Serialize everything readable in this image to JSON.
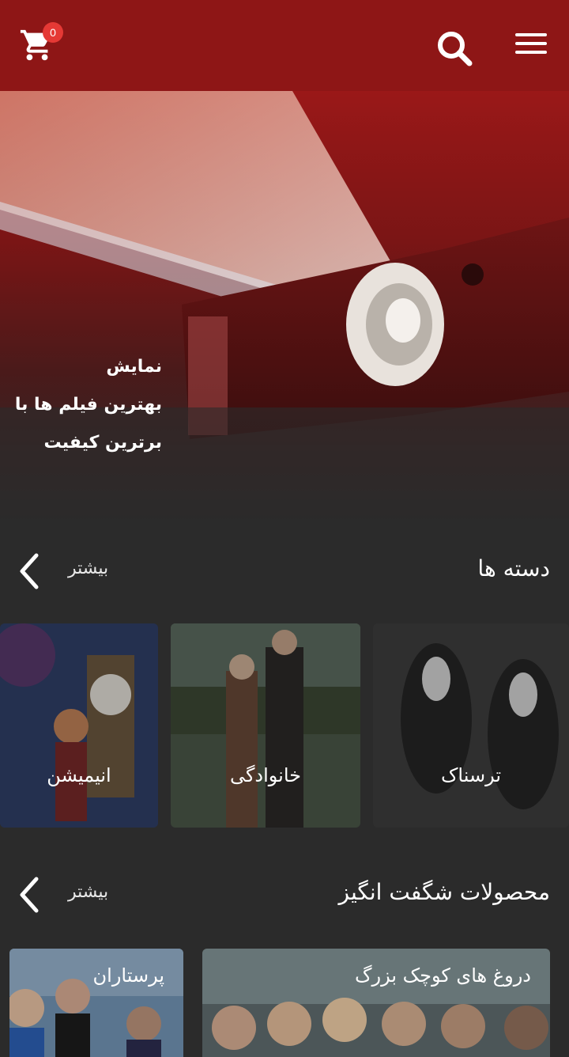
{
  "header": {
    "cart_count": "0",
    "icons": {
      "cart": "cart-icon",
      "search": "search-icon",
      "menu": "menu-icon"
    },
    "background": "#8e1616"
  },
  "hero": {
    "lines": [
      "نمایش",
      "بهترین فیلم ها با",
      "برترین کیفیت"
    ]
  },
  "categories": {
    "title": "دسته ها",
    "more": "بیشتر",
    "items": [
      {
        "label": "ترسناک"
      },
      {
        "label": "خانوادگی"
      },
      {
        "label": "انیمیشن"
      }
    ]
  },
  "products": {
    "title": "محصولات شگفت انگیز",
    "more": "بیشتر",
    "items": [
      {
        "label": "دروغ های کوچک بزرگ"
      },
      {
        "label": "پرستاران"
      }
    ]
  }
}
